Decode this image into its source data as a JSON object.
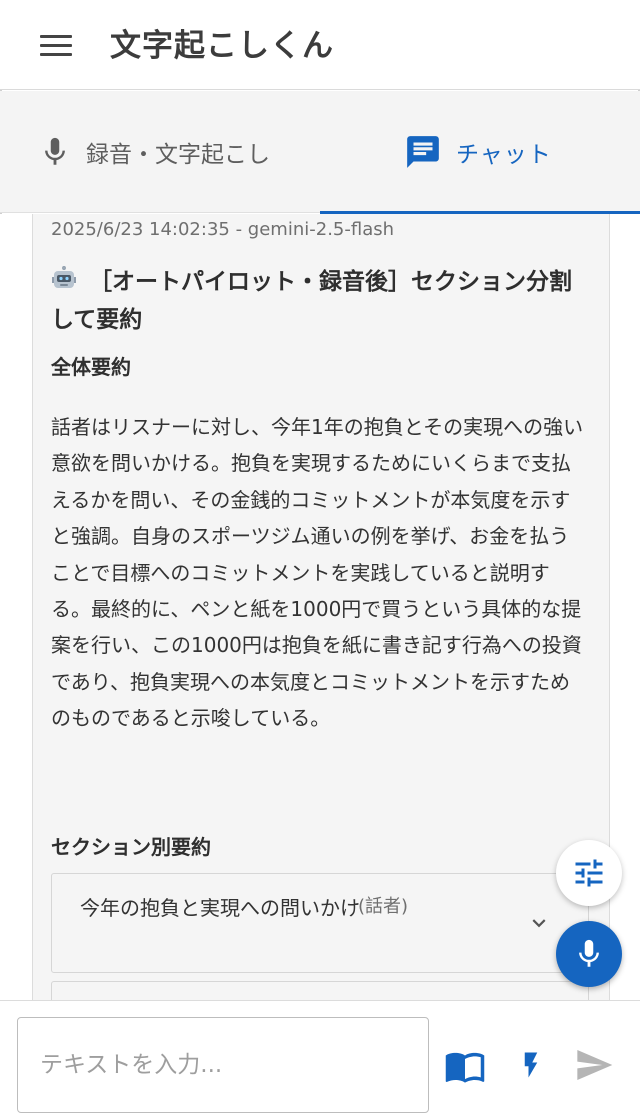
{
  "app": {
    "title": "文字起こしくん"
  },
  "tabs": [
    {
      "label": "録音・文字起こし",
      "icon": "mic-icon",
      "active": false
    },
    {
      "label": "チャット",
      "icon": "chat-icon",
      "active": true
    }
  ],
  "colors": {
    "accent": "#1565c0",
    "card_bg": "#f5f5f5",
    "tab_bg": "#f4f4f4"
  },
  "message": {
    "meta": "2025/6/23 14:02:35 - gemini-2.5-flash",
    "avatar_icon": "robot-icon",
    "title": "［オートパイロット・録音後］セクション分割して要約",
    "overall_heading": "全体要約",
    "overall_summary": "話者はリスナーに対し、今年1年の抱負とその実現への強い意欲を問いかける。抱負を実現するためにいくらまで支払えるかを問い、その金銭的コミットメントが本気度を示すと強調。自身のスポーツジム通いの例を挙げ、お金を払うことで目標へのコミットメントを実践していると説明する。最終的に、ペンと紙を1000円で買うという具体的な提案を行い、この1000円は抱負を紙に書き記す行為への投資であり、抱負実現への本気度とコミットメントを示すためのものであると示唆している。",
    "sections_heading": "セクション別要約",
    "sections": [
      {
        "title": "今年の抱負と実現への問いかけ",
        "speaker": "(話者)"
      }
    ]
  },
  "input": {
    "placeholder": "テキストを入力..."
  },
  "actions": {
    "settings_icon": "tune-icon",
    "mic_icon": "mic-icon",
    "book_icon": "book-icon",
    "bolt_icon": "bolt-icon",
    "send_icon": "send-icon"
  }
}
